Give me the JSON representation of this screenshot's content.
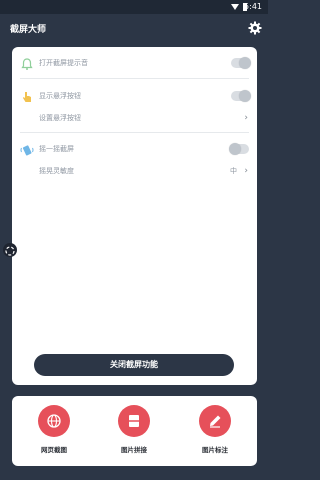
{
  "status_bar": {
    "time": "5:41"
  },
  "app": {
    "title": "截屏大师"
  },
  "settings": {
    "notify_sound_label": "打开截屏提示音",
    "show_float_label": "显示悬浮按钮",
    "float_settings_label": "设置悬浮按钮",
    "shake_label": "摇一摇截屏",
    "shake_sensitivity_label": "摇晃灵敏度",
    "shake_sensitivity_value": "中"
  },
  "toggles": {
    "notify_sound_on": true,
    "show_float_on": true,
    "shake_on": false
  },
  "close_button": "关闭截屏功能",
  "tools": [
    {
      "label": "网页截图",
      "icon": "globe-icon"
    },
    {
      "label": "图片拼接",
      "icon": "split-image-icon"
    },
    {
      "label": "图片标注",
      "icon": "pencil-icon"
    }
  ],
  "colors": {
    "dark": "#2c3646",
    "accent_red": "#e6505a",
    "card": "#ffffff"
  }
}
